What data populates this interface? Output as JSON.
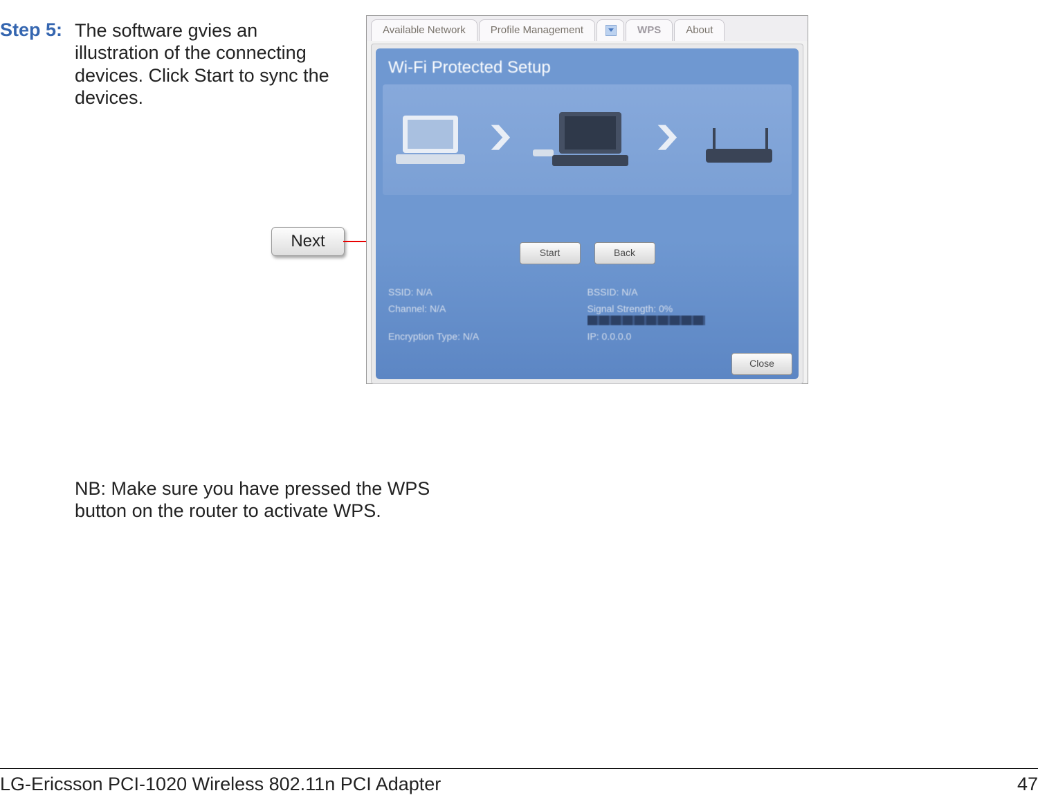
{
  "step": {
    "label": "Step 5:",
    "text": "The software gvies an illustration of the connecting devices. Click Start to sync the devices.",
    "nb": "NB: Make sure you have pressed the WPS button on the router to activate WPS."
  },
  "callout": {
    "label": "Next"
  },
  "tabs": {
    "available": "Available Network",
    "profile": "Profile Management",
    "wps": "WPS",
    "about": "About"
  },
  "panel": {
    "title": "Wi-Fi Protected Setup",
    "start": "Start",
    "back": "Back",
    "info": {
      "ssid_label": "SSID:",
      "ssid_value": "N/A",
      "channel_label": "Channel:",
      "channel_value": "N/A",
      "enc_label": "Encryption Type:",
      "enc_value": "N/A",
      "bssid_label": "BSSID:",
      "bssid_value": "N/A",
      "signal_label": "Signal Strength:",
      "signal_value": "0%",
      "ip_label": "IP:",
      "ip_value": "0.0.0.0"
    },
    "close": "Close"
  },
  "footer": {
    "product": "LG-Ericsson PCI-1020 Wireless 802.11n PCI Adapter",
    "page": "47"
  }
}
